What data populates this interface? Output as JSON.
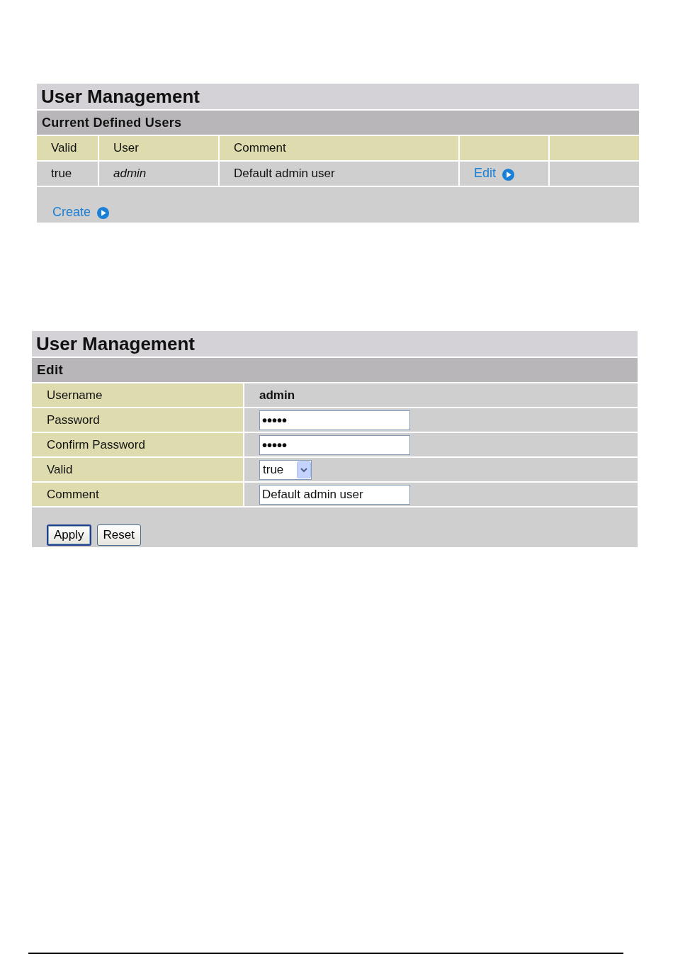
{
  "user_list": {
    "title": "User Management",
    "section": "Current Defined Users",
    "columns": [
      "Valid",
      "User",
      "Comment"
    ],
    "rows": [
      {
        "valid": "true",
        "user": "admin",
        "comment": "Default admin user",
        "action": "Edit"
      }
    ],
    "create_link": "Create"
  },
  "user_edit": {
    "title": "User Management",
    "section": "Edit",
    "fields": [
      {
        "label": "Username",
        "kind": "text",
        "value": "admin"
      },
      {
        "label": "Password",
        "kind": "password",
        "value": "•••••"
      },
      {
        "label": "Confirm Password",
        "kind": "password",
        "value": "•••••"
      },
      {
        "label": "Valid",
        "kind": "select",
        "value": "true"
      },
      {
        "label": "Comment",
        "kind": "input",
        "value": "Default admin user"
      }
    ],
    "buttons": [
      {
        "label": "Apply",
        "default": true
      },
      {
        "label": "Reset",
        "default": false
      }
    ]
  }
}
